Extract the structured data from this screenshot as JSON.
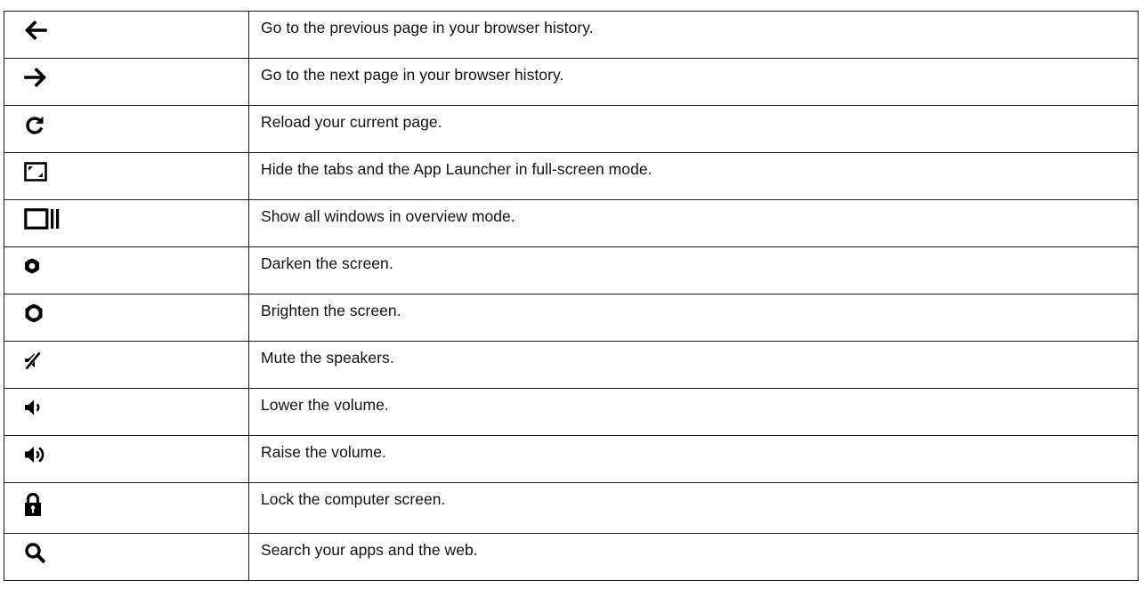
{
  "shortcut_keys": [
    {
      "icon": "arrow-left-icon",
      "description": "Go to the previous page in your browser history."
    },
    {
      "icon": "arrow-right-icon",
      "description": "Go to the next page in your browser history."
    },
    {
      "icon": "refresh-icon",
      "description": "Reload your current page."
    },
    {
      "icon": "fullscreen-icon",
      "description": "Hide the tabs and the App Launcher in full-screen mode."
    },
    {
      "icon": "overview-icon",
      "description": "Show all windows in overview mode."
    },
    {
      "icon": "brightness-down-icon",
      "description": "Darken the screen."
    },
    {
      "icon": "brightness-up-icon",
      "description": "Brighten the screen."
    },
    {
      "icon": "mute-icon",
      "description": "Mute the speakers."
    },
    {
      "icon": "volume-down-icon",
      "description": "Lower the volume."
    },
    {
      "icon": "volume-up-icon",
      "description": "Raise the volume."
    },
    {
      "icon": "lock-icon",
      "description": "Lock the computer screen."
    },
    {
      "icon": "search-icon",
      "description": "Search your apps and the web."
    }
  ]
}
